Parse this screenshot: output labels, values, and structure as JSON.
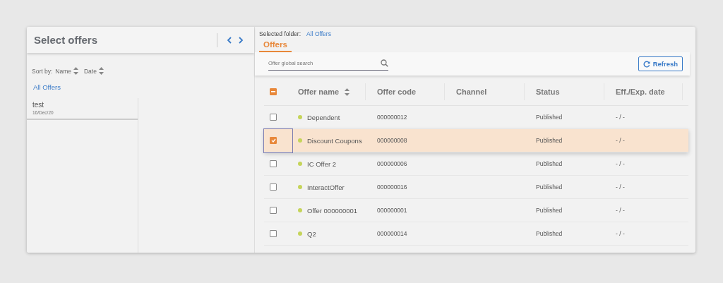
{
  "left_panel": {
    "title": "Select offers",
    "sort": {
      "label": "Sort by:",
      "options": [
        "Name",
        "Date"
      ]
    },
    "folder_link": "All Offers",
    "items": [
      {
        "name": "test",
        "date": "16/Dec/20"
      }
    ]
  },
  "right_panel": {
    "selected_folder": {
      "label": "Selected folder:",
      "value": "All Offers"
    },
    "tabs": [
      {
        "label": "Offers",
        "selected": true
      }
    ],
    "search": {
      "placeholder": "Offer global search"
    },
    "refresh_button": "Refresh",
    "table": {
      "select_all": {
        "indeterminate": true
      },
      "columns": [
        {
          "label": "Offer name",
          "sortable": true
        },
        {
          "label": "Offer code",
          "sortable": false
        },
        {
          "label": "Channel",
          "sortable": false
        },
        {
          "label": "Status",
          "sortable": false
        },
        {
          "label": "Eff./Exp. date",
          "sortable": false
        }
      ],
      "rows": [
        {
          "selected": false,
          "color": "#c5d45a",
          "name": "Dependent",
          "code": "000000012",
          "status": "Published",
          "dates": "- / -"
        },
        {
          "selected": true,
          "color": "#c5d45a",
          "name": "Discount Coupons",
          "code": "000000008",
          "status": "Published",
          "dates": "- / -"
        },
        {
          "selected": false,
          "color": "#c5d45a",
          "name": "IC Offer 2",
          "code": "000000006",
          "status": "Published",
          "dates": "- / -"
        },
        {
          "selected": false,
          "color": "#c5d45a",
          "name": "InteractOffer",
          "code": "000000016",
          "status": "Published",
          "dates": "- / -"
        },
        {
          "selected": false,
          "color": "#c5d45a",
          "name": "Offer 000000001",
          "code": "000000001",
          "status": "Published",
          "dates": "- / -"
        },
        {
          "selected": false,
          "color": "#c5d45a",
          "name": "Q2",
          "code": "000000014",
          "status": "Published",
          "dates": "- / -"
        }
      ]
    }
  }
}
